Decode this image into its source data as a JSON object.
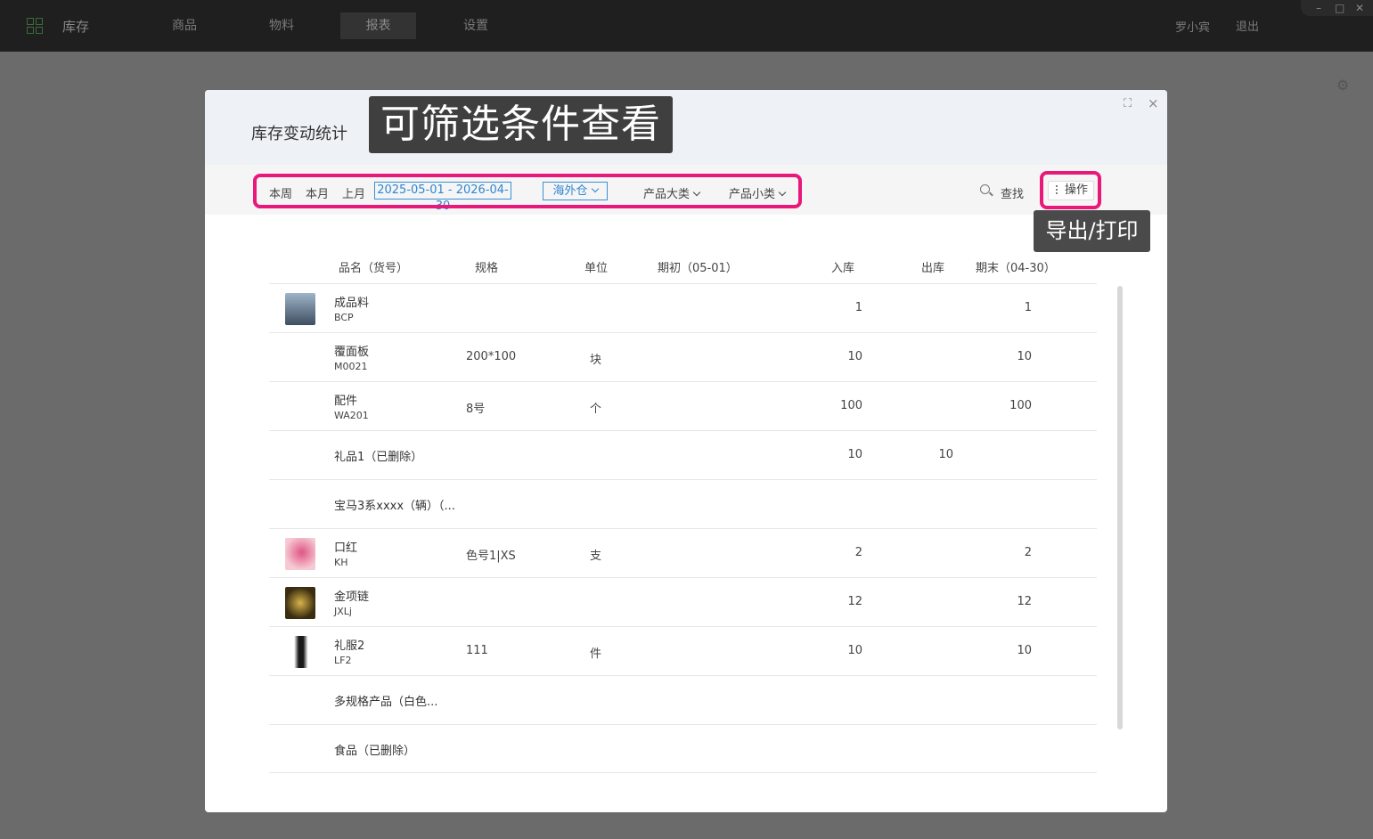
{
  "app": {
    "title": "库存",
    "nav": [
      {
        "label": "商品"
      },
      {
        "label": "物料"
      },
      {
        "label": "报表",
        "active": true
      },
      {
        "label": "设置"
      }
    ],
    "user": "罗小宾",
    "logout": "退出",
    "window_controls": {
      "minimize": "–",
      "maximize": "□",
      "close": "✕"
    }
  },
  "modal": {
    "title": "库存变动统计",
    "filters": {
      "this_week": "本周",
      "this_month": "本月",
      "last_month": "上月",
      "date_range": "2025-05-01 - 2026-04-30",
      "warehouse": "海外仓",
      "category_major": "产品大类",
      "category_minor": "产品小类"
    },
    "search_label": "查找",
    "ops_label": "操作"
  },
  "table": {
    "headers": {
      "name": "品名（货号）",
      "spec": "规格",
      "unit": "单位",
      "opening": "期初（05-01）",
      "in": "入库",
      "out": "出库",
      "closing": "期末（04-30）"
    },
    "rows": [
      {
        "name": "成品料",
        "code": "BCP",
        "spec": "",
        "unit": "",
        "in": "1",
        "out": "",
        "closing": "1",
        "thumb": "#6d8299"
      },
      {
        "name": "覆面板",
        "code": "M0021",
        "spec": "200*100",
        "unit": "块",
        "in": "10",
        "out": "",
        "closing": "10",
        "thumb": ""
      },
      {
        "name": "配件",
        "code": "WA201",
        "spec": "8号",
        "unit": "个",
        "in": "100",
        "out": "",
        "closing": "100",
        "thumb": ""
      },
      {
        "name": "礼品1（已删除）",
        "code": "",
        "spec": "",
        "unit": "",
        "in": "10",
        "out": "10",
        "closing": "",
        "thumb": ""
      },
      {
        "name": "宝马3系xxxx（辆）（...",
        "code": "",
        "spec": "",
        "unit": "",
        "in": "",
        "out": "",
        "closing": "",
        "thumb": ""
      },
      {
        "name": "口红",
        "code": "KH",
        "spec": "色号1|XS",
        "unit": "支",
        "in": "2",
        "out": "",
        "closing": "2",
        "thumb": "#c9406a"
      },
      {
        "name": "金项链",
        "code": "JXLj",
        "spec": "",
        "unit": "",
        "in": "12",
        "out": "",
        "closing": "12",
        "thumb": "#8a6a1c"
      },
      {
        "name": "礼服2",
        "code": "LF2",
        "spec": "111",
        "unit": "件",
        "in": "10",
        "out": "",
        "closing": "10",
        "thumb": "#222222"
      },
      {
        "name": "多规格产品（白色...",
        "code": "",
        "spec": "",
        "unit": "",
        "in": "",
        "out": "",
        "closing": "",
        "thumb": ""
      },
      {
        "name": "食品（已删除）",
        "code": "",
        "spec": "",
        "unit": "",
        "in": "",
        "out": "",
        "closing": "",
        "thumb": ""
      }
    ]
  },
  "annotations": {
    "filter_callout": "可筛选条件查看",
    "ops_callout": "导出/打印"
  },
  "colors": {
    "accent_blue": "#2f86d1",
    "highlight_pink": "#e8197a",
    "topbar": "#1f1f1f"
  }
}
